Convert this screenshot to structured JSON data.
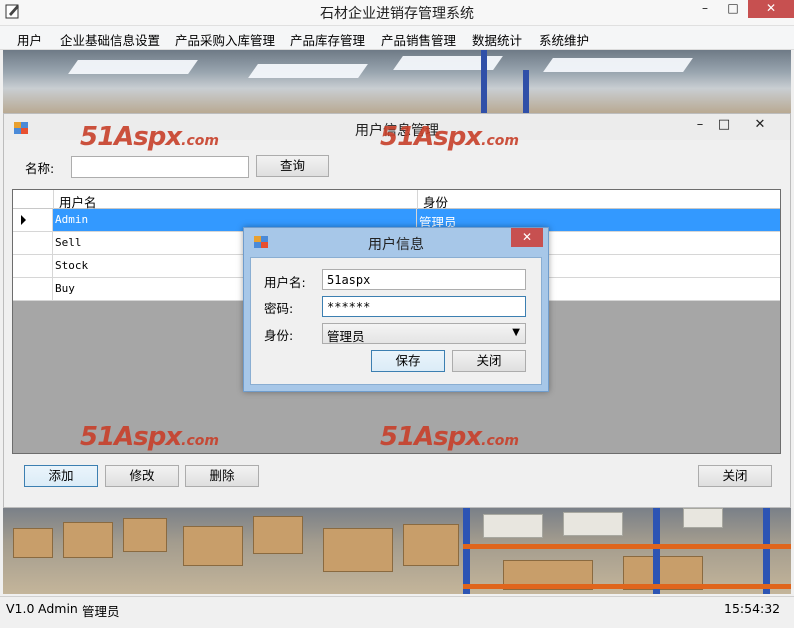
{
  "main_window": {
    "title": "石材企业进销存管理系统",
    "controls": {
      "minimize": "–",
      "maximize": "□",
      "close": "✕"
    }
  },
  "menu": {
    "items": [
      {
        "label": "用户"
      },
      {
        "label": "企业基础信息设置"
      },
      {
        "label": "产品采购入库管理"
      },
      {
        "label": "产品库存管理"
      },
      {
        "label": "产品销售管理"
      },
      {
        "label": "数据统计"
      },
      {
        "label": "系统维护"
      }
    ]
  },
  "user_management": {
    "title": "用户信息管理",
    "controls": {
      "minimize": "–",
      "maximize": "□",
      "close": "✕"
    },
    "search": {
      "label": "名称:",
      "value": "",
      "button": "查询"
    },
    "grid": {
      "columns": [
        "用户名",
        "身份"
      ],
      "rows": [
        {
          "username": "Admin",
          "role": "管理员",
          "selected": true
        },
        {
          "username": "Sell",
          "role": ""
        },
        {
          "username": "Stock",
          "role": ""
        },
        {
          "username": "Buy",
          "role": ""
        }
      ]
    },
    "buttons": {
      "add": "添加",
      "edit": "修改",
      "delete": "删除",
      "close": "关闭"
    }
  },
  "user_dialog": {
    "title": "用户信息",
    "close": "✕",
    "username_label": "用户名:",
    "username_value": "51aspx",
    "password_label": "密码:",
    "password_value": "******",
    "role_label": "身份:",
    "role_value": "管理员",
    "save_button": "保存",
    "close_button": "关闭"
  },
  "watermark": {
    "brand": "51Aspx",
    "suffix": ".com"
  },
  "status_bar": {
    "version": "V1.0",
    "user": "Admin",
    "role": "管理员",
    "time": "15:54:32"
  },
  "colors": {
    "selection": "#3399ff",
    "close_red": "#c75050",
    "dialog_frame": "#a7c7e8",
    "watermark": "#c8402a"
  }
}
